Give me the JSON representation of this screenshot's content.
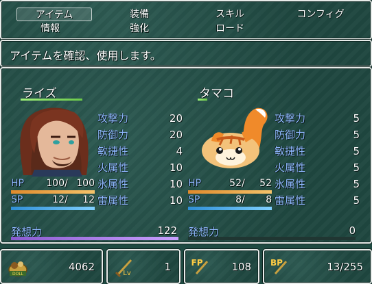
{
  "menu": {
    "items": [
      {
        "label": "アイテム",
        "selected": true
      },
      {
        "label": "装備",
        "selected": false
      },
      {
        "label": "スキル",
        "selected": false
      },
      {
        "label": "コンフィグ",
        "selected": false
      },
      {
        "label": "情報",
        "selected": false
      },
      {
        "label": "強化",
        "selected": false
      },
      {
        "label": "ロード",
        "selected": false
      }
    ]
  },
  "help": {
    "text": "アイテムを確認、使用します。"
  },
  "actors": [
    {
      "name": "ライズ",
      "params": [
        {
          "label": "攻撃力",
          "value": "20"
        },
        {
          "label": "防御力",
          "value": "20"
        },
        {
          "label": "敏捷性",
          "value": "4"
        },
        {
          "label": "火属性",
          "value": "10"
        },
        {
          "label": "氷属性",
          "value": "10"
        },
        {
          "label": "雷属性",
          "value": "10"
        }
      ],
      "hp_label": "HP",
      "hp": "100",
      "mhp": "100",
      "hp_rate": 1.0,
      "sp_label": "SP",
      "sp": "12",
      "msp": "12",
      "sp_rate": 1.0,
      "hasso_label": "発想力",
      "hasso": "122",
      "hasso_rate": 1.0
    },
    {
      "name": "タマコ",
      "params": [
        {
          "label": "攻撃力",
          "value": "5"
        },
        {
          "label": "防御力",
          "value": "5"
        },
        {
          "label": "敏捷性",
          "value": "5"
        },
        {
          "label": "火属性",
          "value": "5"
        },
        {
          "label": "氷属性",
          "value": "5"
        },
        {
          "label": "雷属性",
          "value": "5"
        }
      ],
      "hp_label": "HP",
      "hp": "52",
      "mhp": "52",
      "hp_rate": 1.0,
      "sp_label": "SP",
      "sp": "8",
      "msp": "8",
      "sp_rate": 1.0,
      "hasso_label": "発想力",
      "hasso": "0",
      "hasso_rate": 0.0
    }
  ],
  "footer": {
    "doll_icon_label": "DOLL",
    "gold": "4062",
    "level_icon_label": "Lv",
    "level": "1",
    "fp_icon_label": "FP",
    "fp": "108",
    "bp_icon_label": "BP",
    "bp": "13/255"
  },
  "colors": {
    "hp_gauge": [
      "#e08a2c",
      "#f5c36a"
    ],
    "sp_gauge": [
      "#2f8fd6",
      "#7fd0ff"
    ],
    "hasso_gauge": [
      "#8a5ad0",
      "#c9a0ff"
    ],
    "system_text": "#8fb8ff",
    "window_bg": "#1f4740"
  }
}
